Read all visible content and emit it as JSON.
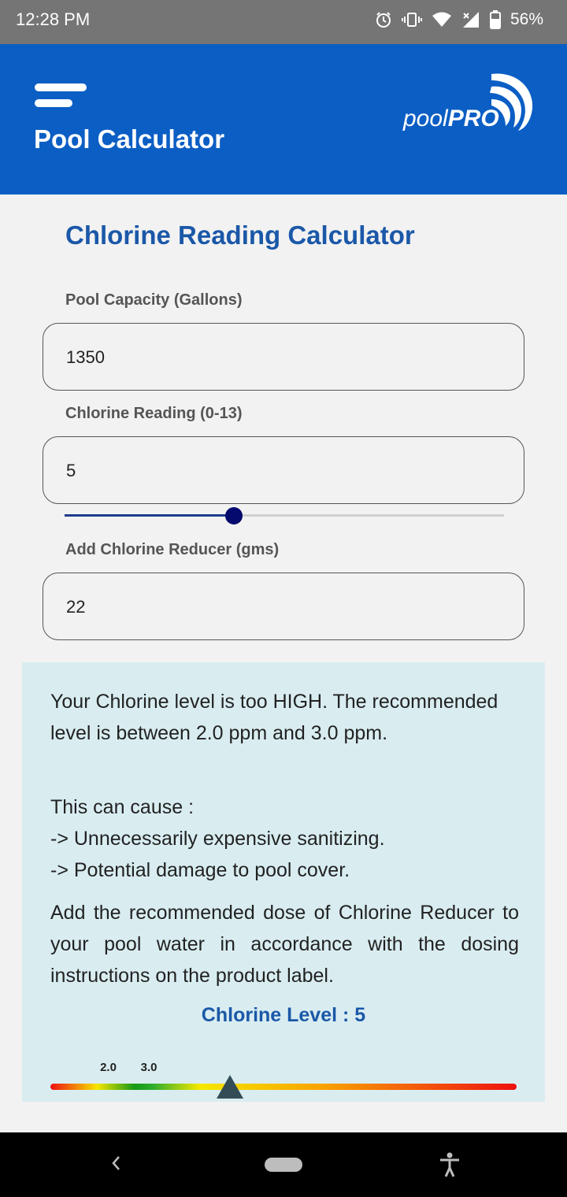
{
  "status_bar": {
    "time": "12:28 PM",
    "battery": "56%",
    "icons": [
      "alarm-icon",
      "vibrate-icon",
      "wifi-icon",
      "signal-icon",
      "battery-icon"
    ]
  },
  "app_bar": {
    "title": "Pool Calculator",
    "logo_text_regular": "pool",
    "logo_text_bold": "PRO",
    "menu_icon": "menu-icon",
    "background_color": "#0b5ec4"
  },
  "calculator": {
    "title": "Chlorine Reading Calculator",
    "pool_capacity": {
      "label": "Pool Capacity (Gallons)",
      "value": "1350"
    },
    "chlorine_reading": {
      "label": "Chlorine Reading (0-13)",
      "value": "5",
      "slider_min": 0,
      "slider_max": 13,
      "slider_value": 5
    },
    "reducer": {
      "label": "Add Chlorine Reducer (gms)",
      "value": "22"
    }
  },
  "result": {
    "message": "Your Chlorine level is too HIGH. The recommended level is between 2.0 ppm and 3.0 ppm.",
    "causes_heading": "This can cause :",
    "cause_1": "-> Unnecessarily expensive sanitizing.",
    "cause_2": "-> Potential damage to pool cover.",
    "advice": "Add the recommended dose of Chlorine Reducer to your pool water in accordance with the dosing instructions on the product label.",
    "level_label": "Chlorine Level : 5",
    "range_low": "2.0",
    "range_high": "3.0",
    "scale_min": 0,
    "scale_max": 13,
    "level_value": 5,
    "panel_color": "#d9edf1"
  },
  "nav_bar": {
    "icons": [
      "back-icon",
      "home-pill",
      "accessibility-icon"
    ]
  }
}
